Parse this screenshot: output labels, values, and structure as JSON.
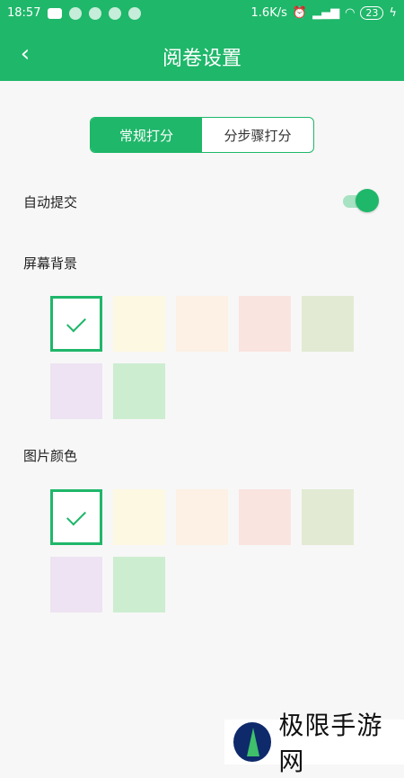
{
  "status_bar": {
    "time": "18:57",
    "net_speed": "1.6K/s",
    "battery": "23"
  },
  "header": {
    "title": "阅卷设置"
  },
  "tabs": [
    {
      "label": "常规打分",
      "active": true
    },
    {
      "label": "分步骤打分",
      "active": false
    }
  ],
  "auto_submit": {
    "label": "自动提交",
    "enabled": true
  },
  "screen_background": {
    "label": "屏幕背景",
    "swatches": [
      "#ffffff",
      "#fdf8e2",
      "#fdf0e4",
      "#fae4e0",
      "#e2ead3",
      "#ede3f2",
      "#cdedd1"
    ],
    "selected_index": 0
  },
  "image_color": {
    "label": "图片颜色",
    "swatches": [
      "#ffffff",
      "#fdf8e2",
      "#fdf0e4",
      "#fae4e0",
      "#e2ead3",
      "#ede3f2",
      "#cdedd1"
    ],
    "selected_index": 0
  },
  "watermark": {
    "text": "极限手游网"
  },
  "colors": {
    "accent": "#1fb76a"
  }
}
